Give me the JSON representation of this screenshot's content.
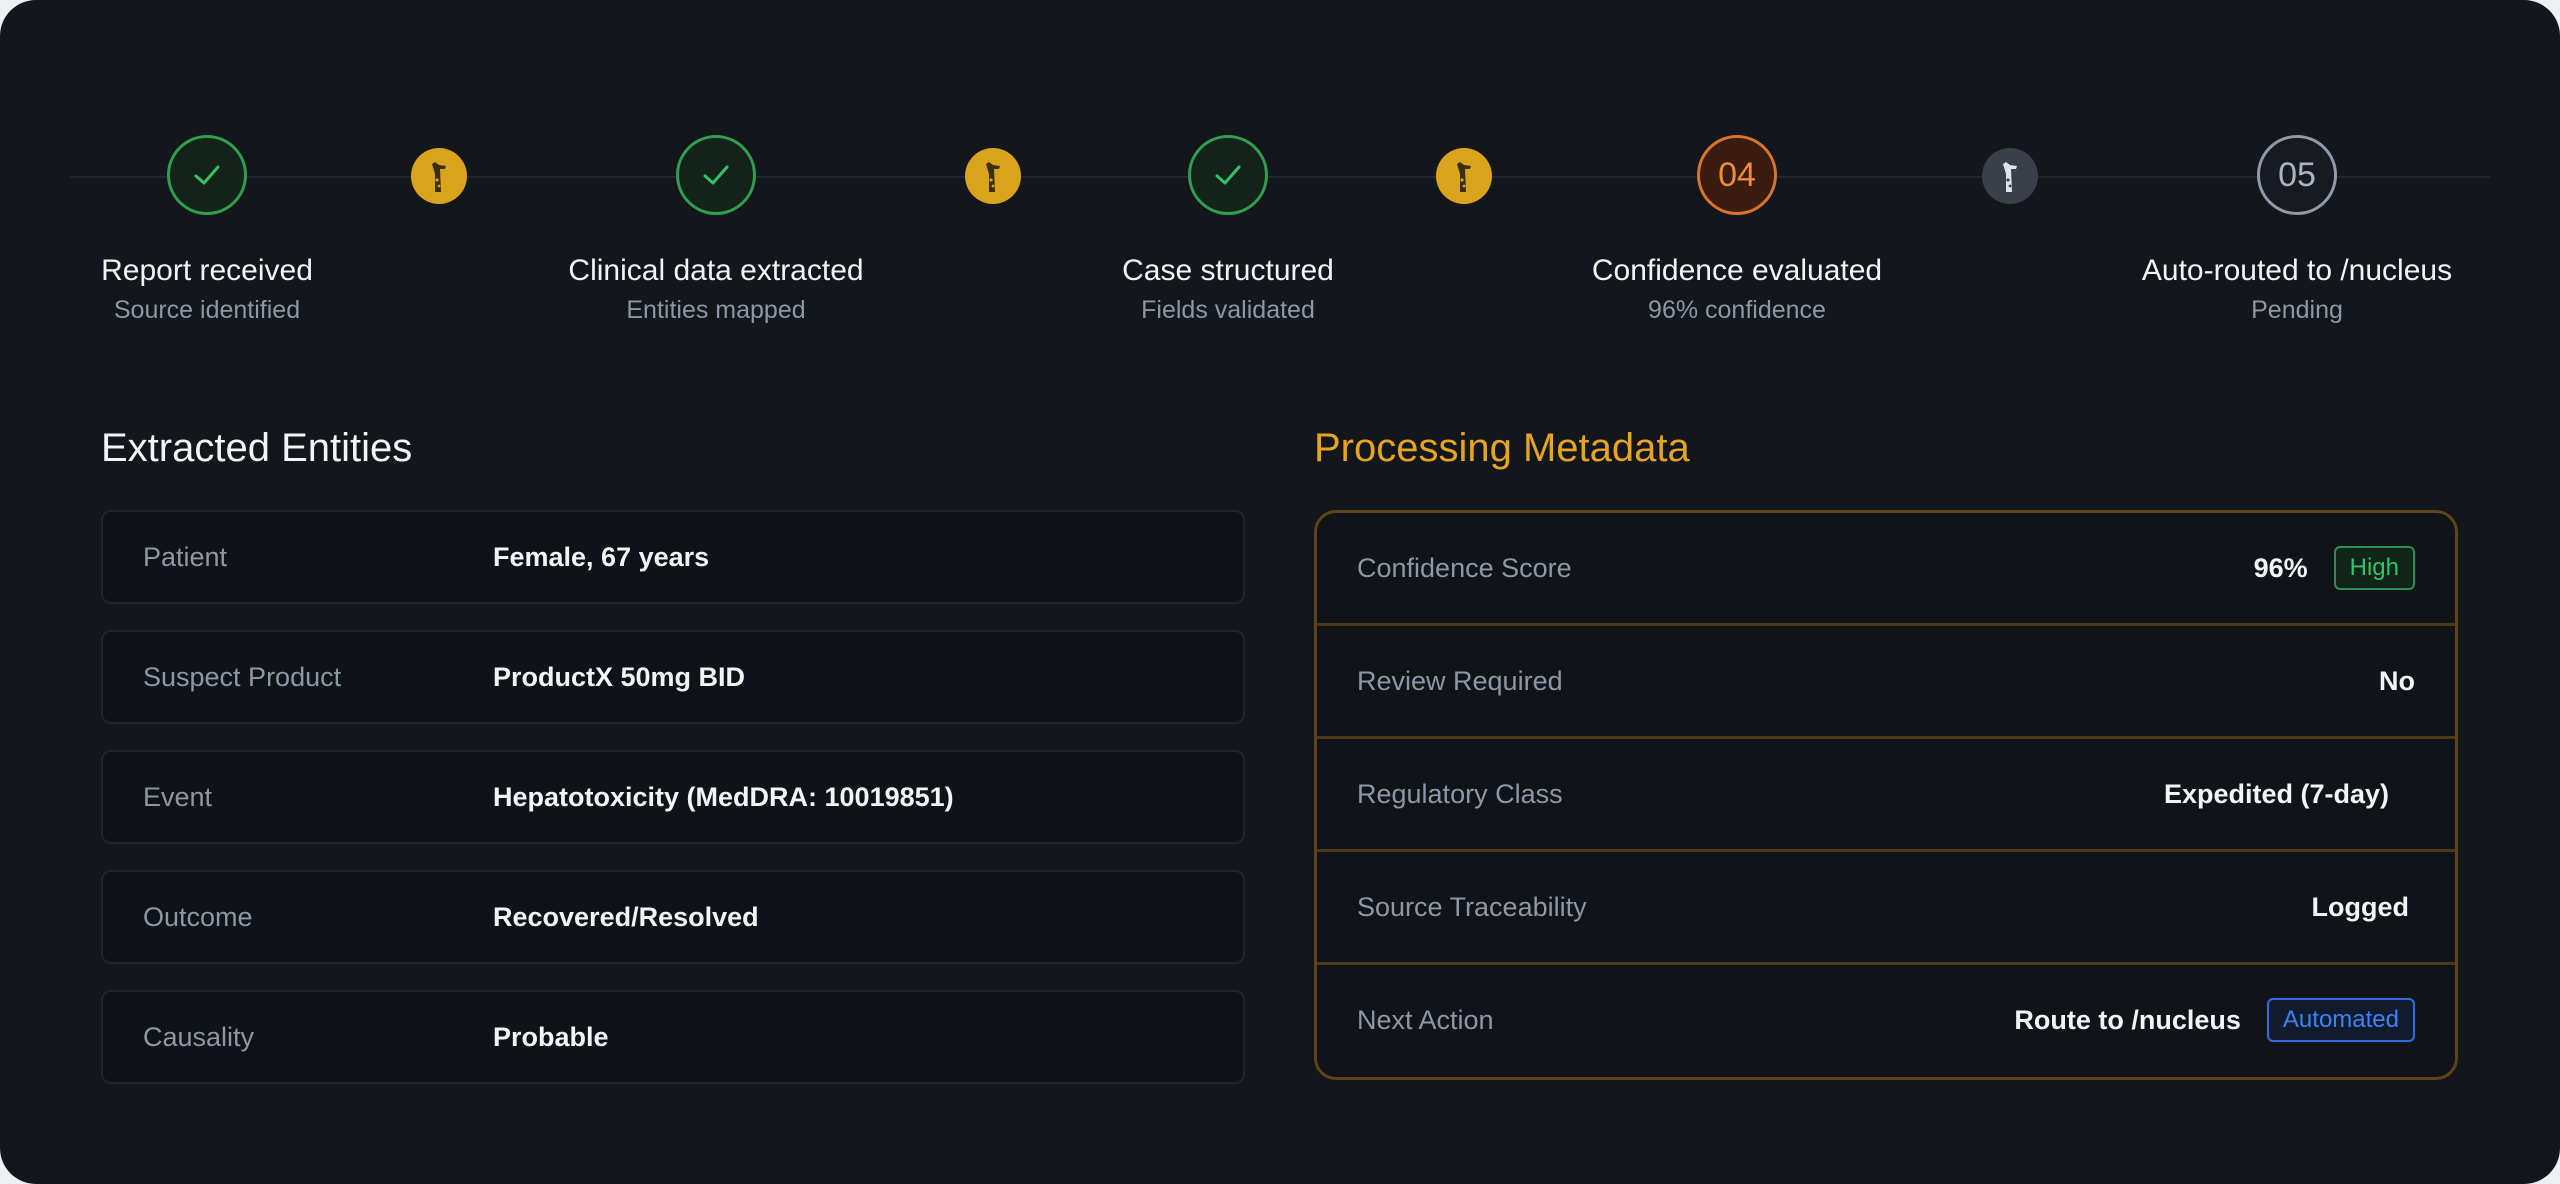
{
  "pipeline": {
    "steps": [
      {
        "title": "Report received",
        "subtitle": "Source identified",
        "state": "done",
        "marker": ""
      },
      {
        "title": "Clinical data extracted",
        "subtitle": "Entities mapped",
        "state": "done",
        "marker": ""
      },
      {
        "title": "Case structured",
        "subtitle": "Fields validated",
        "state": "done",
        "marker": ""
      },
      {
        "title": "Confidence evaluated",
        "subtitle": "96% confidence",
        "state": "active",
        "marker": "04"
      },
      {
        "title": "Auto-routed to /nucleus",
        "subtitle": "Pending",
        "state": "pending",
        "marker": "05"
      }
    ],
    "connectors": [
      {
        "icon": "giraffe-icon",
        "color": "#d9a31c"
      },
      {
        "icon": "giraffe-icon",
        "color": "#d9a31c"
      },
      {
        "icon": "giraffe-icon",
        "color": "#d9a31c"
      },
      {
        "icon": "giraffe-icon",
        "color": "#3a4049"
      }
    ]
  },
  "entities": {
    "title": "Extracted Entities",
    "rows": [
      {
        "label": "Patient",
        "value": "Female, 67 years"
      },
      {
        "label": "Suspect Product",
        "value": "ProductX 50mg BID"
      },
      {
        "label": "Event",
        "value": "Hepatotoxicity (MedDRA: 10019851)"
      },
      {
        "label": "Outcome",
        "value": "Recovered/Resolved"
      },
      {
        "label": "Causality",
        "value": "Probable"
      }
    ]
  },
  "metadata": {
    "title": "Processing Metadata",
    "rows": [
      {
        "label": "Confidence Score",
        "value": "96%",
        "badge": "High"
      },
      {
        "label": "Review Required",
        "value": "No"
      },
      {
        "label": "Regulatory Class",
        "value": "Expedited (7-day)"
      },
      {
        "label": "Source Traceability",
        "value": "Logged"
      },
      {
        "label": "Next Action",
        "value": "Route to /nucleus",
        "badge": "Automated"
      }
    ]
  },
  "colors": {
    "background": "#13161b",
    "success": "#2f9e4f",
    "active": "#d9742a",
    "accent": "#e6a420",
    "info": "#3b82f6"
  }
}
